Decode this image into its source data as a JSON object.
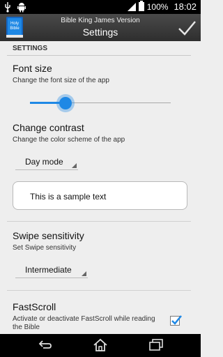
{
  "status_bar": {
    "battery_percent": "100%",
    "time": "18:02",
    "icons": [
      "usb-icon",
      "android-icon",
      "signal-icon",
      "battery-icon"
    ]
  },
  "action_bar": {
    "app_icon_text_line1": "Holy",
    "app_icon_text_line2": "Bible",
    "subtitle": "Bible King James Version",
    "title": "Settings",
    "confirm_icon": "checkmark-icon"
  },
  "settings": {
    "section_header": "SETTINGS",
    "font_size": {
      "title": "Font size",
      "summary": "Change the font size of the app",
      "slider_value_fraction": 0.25
    },
    "contrast": {
      "title": "Change contrast",
      "summary": "Change the color scheme of the app",
      "selected": "Day mode",
      "sample_text": "This is a sample text"
    },
    "swipe": {
      "title": "Swipe sensitivity",
      "summary": "Set Swipe sensitivity",
      "selected": "Intermediate"
    },
    "fastscroll": {
      "title": "FastScroll",
      "summary": "Activate or deactivate FastScroll while reading the Bible",
      "checked": true
    }
  },
  "colors": {
    "accent": "#1e88e5",
    "action_bar": "#3a3a3a",
    "background": "#eeeeee"
  },
  "nav_bar": {
    "icons": [
      "back-icon",
      "home-icon",
      "recent-apps-icon"
    ]
  }
}
